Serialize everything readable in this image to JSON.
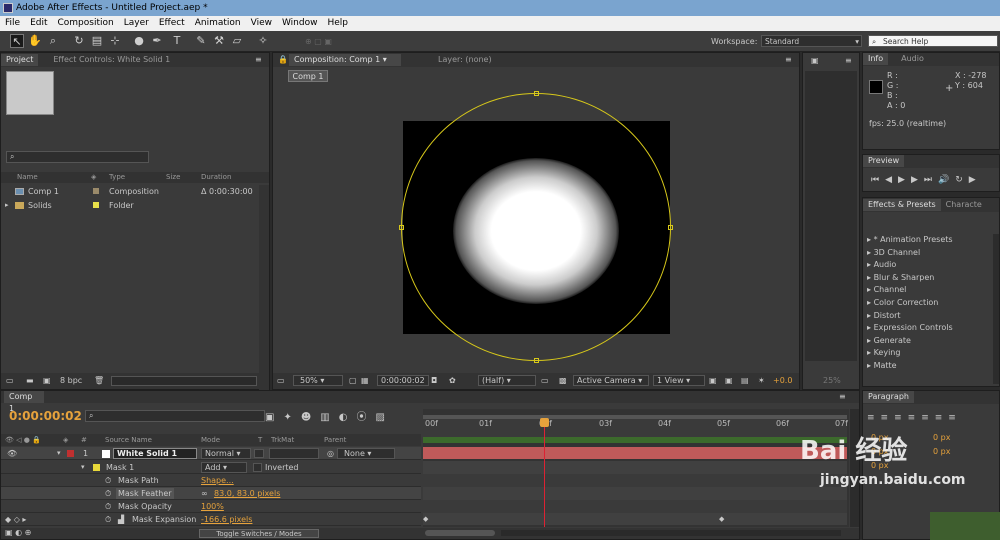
{
  "window": {
    "title": "Adobe After Effects - Untitled Project.aep *"
  },
  "menu": [
    "File",
    "Edit",
    "Composition",
    "Layer",
    "Effect",
    "Animation",
    "View",
    "Window",
    "Help"
  ],
  "workspace": {
    "label": "Workspace:",
    "value": "Standard",
    "search_placeholder": "Search Help"
  },
  "project_panel": {
    "tabs": [
      "Project",
      "Effect Controls: White Solid 1"
    ],
    "columns": {
      "name": "Name",
      "type": "Type",
      "size": "Size",
      "duration": "Duration"
    },
    "rows": [
      {
        "name": "Comp 1",
        "type": "Composition",
        "size": "",
        "duration": "Δ 0:00:30:00"
      },
      {
        "name": "Solids",
        "type": "Folder",
        "size": "",
        "duration": ""
      }
    ],
    "bpc": "8 bpc"
  },
  "comp_panel": {
    "tab": "Composition: Comp 1",
    "layer_tab": "Layer: (none)",
    "crumb": "Comp 1",
    "zoom": "50%",
    "timecode": "0:00:00:02",
    "resolution": "(Half)",
    "camera": "Active Camera",
    "views": "1 View",
    "exposure": "+0.0"
  },
  "info_panel": {
    "tabs": [
      "Info",
      "Audio"
    ],
    "r": "R :",
    "g": "G :",
    "b": "B :",
    "a": "A : 0",
    "x": "X : -278",
    "y": "Y : 604",
    "fps": "fps: 25.0 (realtime)"
  },
  "preview_panel": {
    "tab": "Preview"
  },
  "effects_panel": {
    "tabs": [
      "Effects & Presets",
      "Characte"
    ],
    "items": [
      "* Animation Presets",
      "3D Channel",
      "Audio",
      "Blur & Sharpen",
      "Channel",
      "Color Correction",
      "Distort",
      "Expression Controls",
      "Generate",
      "Keying",
      "Matte"
    ]
  },
  "paragraph_panel": {
    "tab": "Paragraph",
    "values": [
      "0 px",
      "0 px",
      "0 px",
      "0 px",
      "0 px"
    ]
  },
  "timeline": {
    "tab": "Comp 1",
    "timecode": "0:00:00:02",
    "columns": {
      "source": "Source Name",
      "mode": "Mode",
      "t": "T",
      "trkmat": "TrkMat",
      "parent": "Parent"
    },
    "layer": {
      "num": "1",
      "name": "White Solid 1",
      "mode": "Normal",
      "parent": "None"
    },
    "mask": {
      "name": "Mask 1",
      "mode": "Add",
      "inverted": "Inverted"
    },
    "props": [
      {
        "name": "Mask Path",
        "value": "Shape..."
      },
      {
        "name": "Mask Feather",
        "value": "83.0, 83.0 pixels"
      },
      {
        "name": "Mask Opacity",
        "value": "100%"
      },
      {
        "name": "Mask Expansion",
        "value": "-166.6 pixels"
      }
    ],
    "ruler": [
      "00f",
      "01f",
      "02f",
      "03f",
      "04f",
      "05f",
      "06f",
      "07f"
    ],
    "toggle_label": "Toggle Switches / Modes"
  },
  "watermark": {
    "text": "Bai 经验",
    "url": "jingyan.baidu.com"
  },
  "colors": {
    "accent": "#e6a23c",
    "mask": "#d7c81a",
    "layer_bar": "#c05a5a",
    "titlebar": "#7aa4cf"
  }
}
